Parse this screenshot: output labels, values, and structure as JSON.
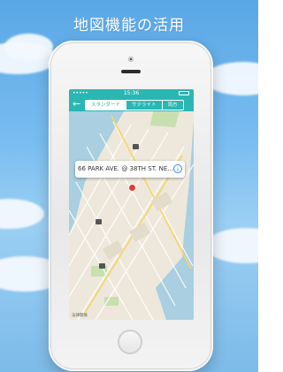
{
  "heading": "地図機能の活用",
  "phone_status": {
    "signal": "•••••",
    "time": "15:36"
  },
  "map_screen": {
    "back_label": "←",
    "map_type_tabs": [
      {
        "label": "スタンダード",
        "active": true
      },
      {
        "label": "サテライト",
        "active": false
      },
      {
        "label": "両方",
        "active": false
      }
    ],
    "callout_text": "66 PARK AVE. @ 38TH ST. NE...",
    "info_glyph": "i",
    "legal_label": "法律関係",
    "accent_color": "#2ab7b3",
    "pin_color": "#e53935"
  }
}
